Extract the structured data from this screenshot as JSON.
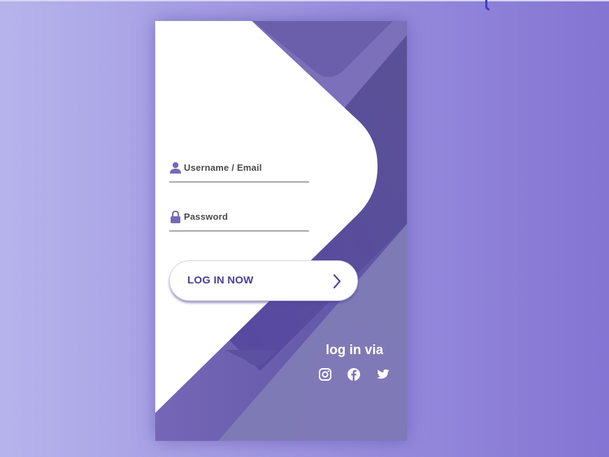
{
  "form": {
    "username_label": "Username / Email",
    "password_label": "Password",
    "submit_label": "LOG IN NOW"
  },
  "social": {
    "heading": "log in via",
    "icons": [
      "instagram-icon",
      "facebook-icon",
      "twitter-icon"
    ]
  },
  "colors": {
    "accent": "#6f62b3",
    "button_text": "#4c3f99",
    "icon": "#7469b6",
    "card_background": "#ffffff"
  }
}
